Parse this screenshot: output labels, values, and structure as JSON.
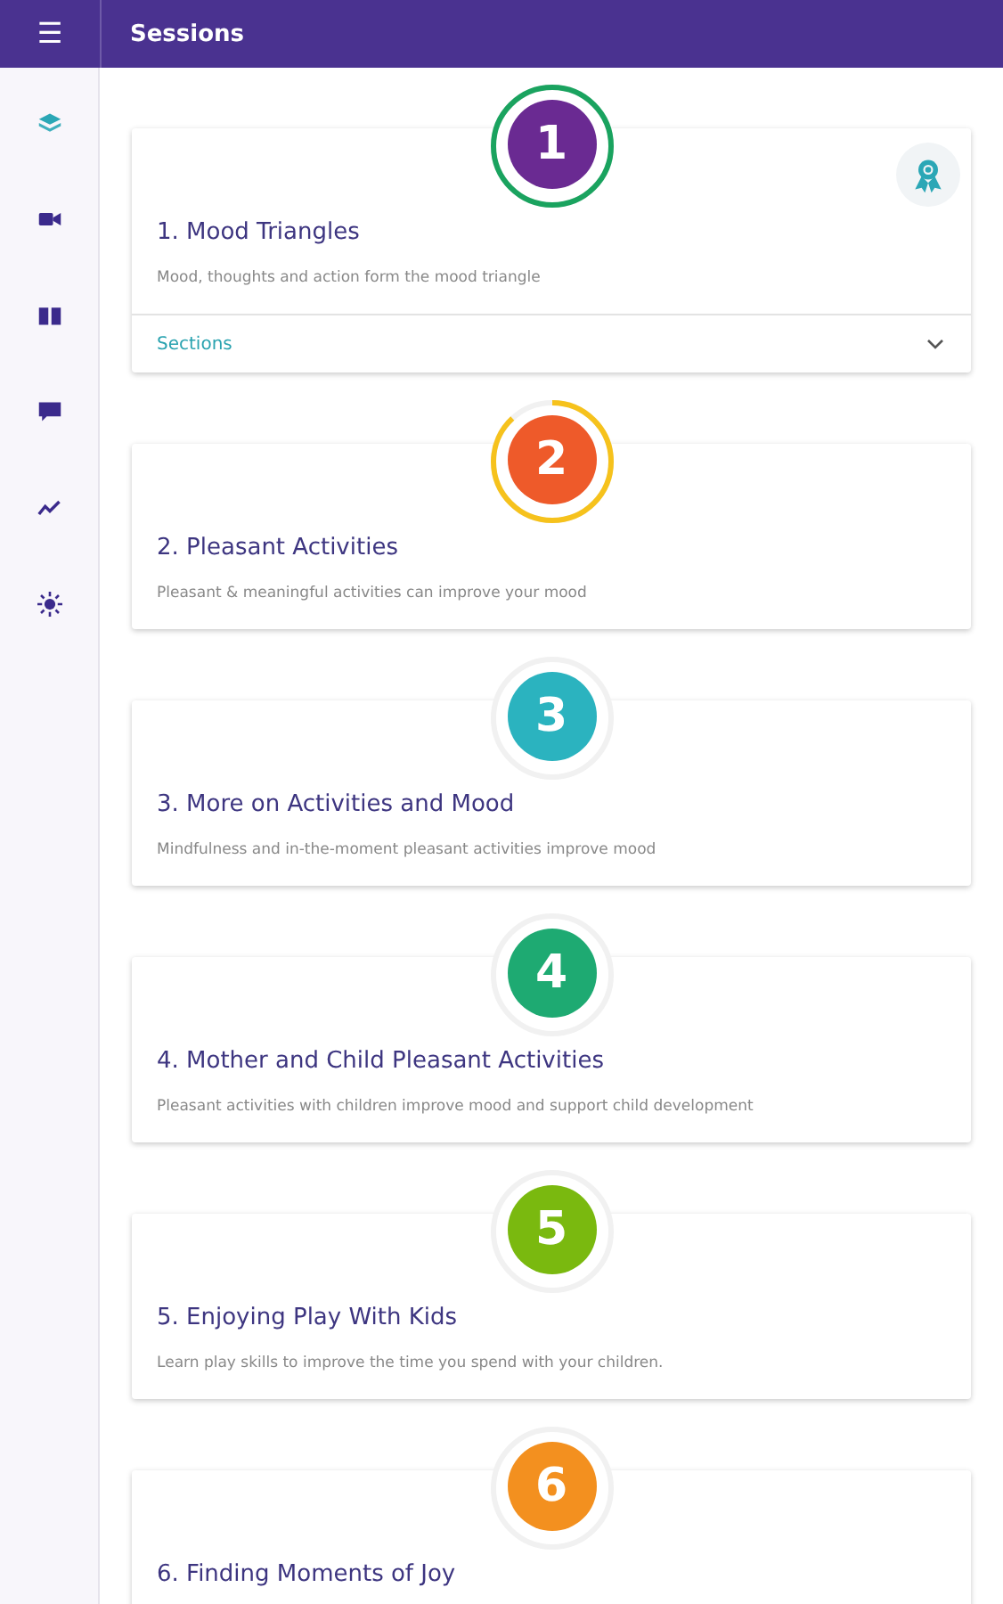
{
  "app_bar": {
    "menu_icon": "☰",
    "title": "Sessions"
  },
  "sidebar": {
    "items": [
      {
        "kind": "layers",
        "selected": true
      },
      {
        "kind": "video",
        "selected": false
      },
      {
        "kind": "book",
        "selected": false
      },
      {
        "kind": "chat",
        "selected": false
      },
      {
        "kind": "chart",
        "selected": false
      },
      {
        "kind": "sun",
        "selected": false
      }
    ]
  },
  "sessions": [
    {
      "number": "1",
      "title": "1. Mood Triangles",
      "description": "Mood, thoughts and action form the mood triangle",
      "color": "#6a2a92",
      "level": 1,
      "award": true,
      "sections": {
        "label": "Sections",
        "expanded": false
      }
    },
    {
      "number": "2",
      "title": "2. Pleasant Activities",
      "description": "Pleasant & meaningful activities can improve your mood",
      "color": "#ee5a2a",
      "level": 0.88
    },
    {
      "number": "3",
      "title": "3. More on Activities and Mood",
      "description": "Mindfulness and in-the-moment pleasant activities improve mood",
      "color": "#2bb3bf"
    },
    {
      "number": "4",
      "title": "4. Mother and Child Pleasant Activities",
      "description": "Pleasant activities with children improve mood and support child development",
      "color": "#1eaa72"
    },
    {
      "number": "5",
      "title": "5. Enjoying Play With Kids",
      "description": "Learn play skills to improve the time you spend with your children.",
      "color": "#7ab90f"
    },
    {
      "number": "6",
      "title": "6. Finding Moments of Joy",
      "color": "#f3901f"
    }
  ]
}
